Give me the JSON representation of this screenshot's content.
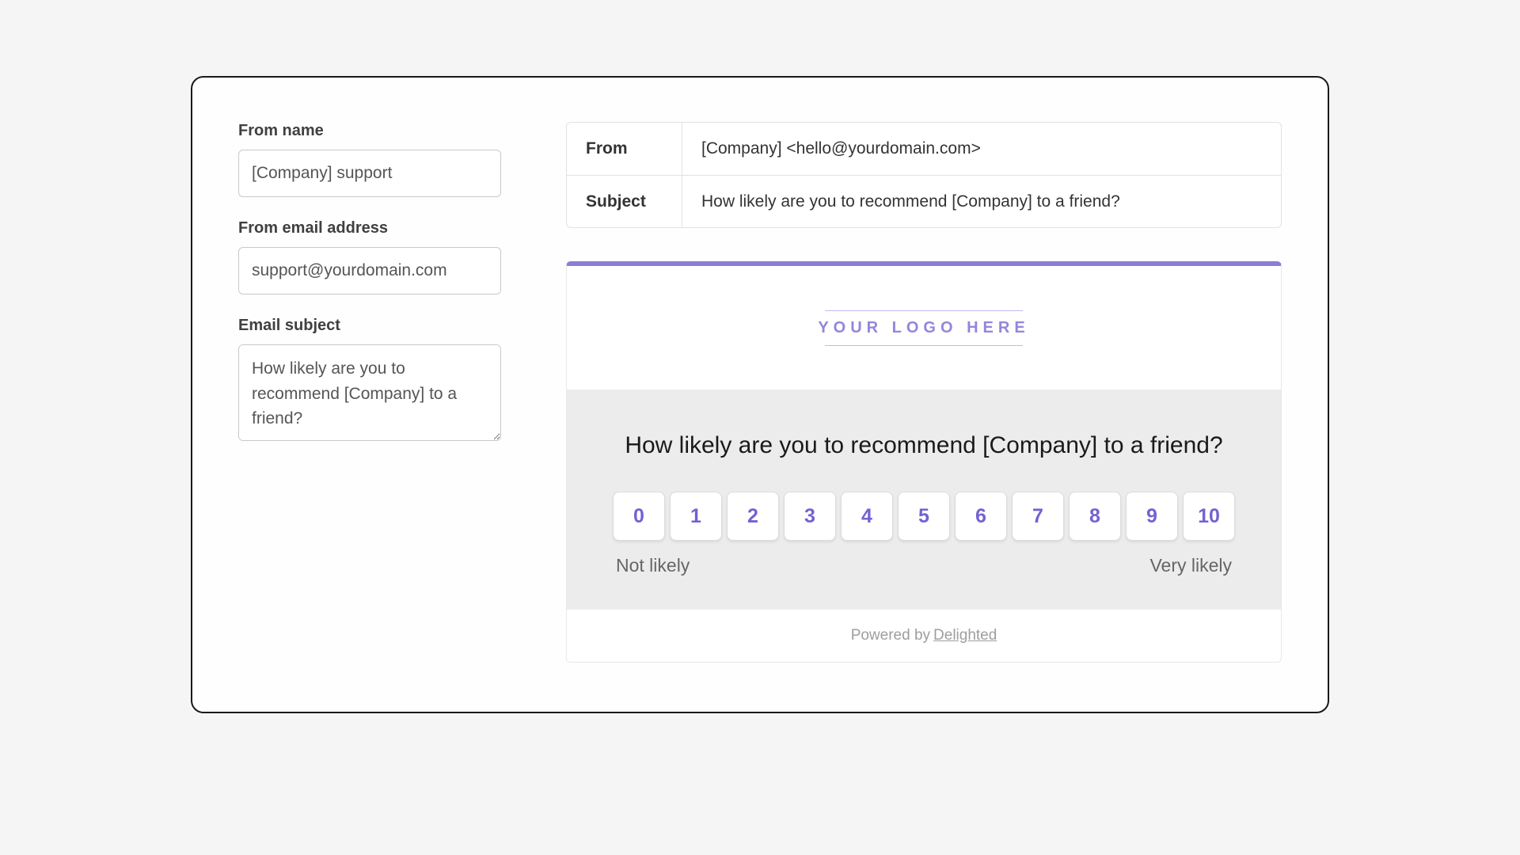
{
  "form": {
    "from_name": {
      "label": "From name",
      "value": "[Company] support"
    },
    "from_email": {
      "label": "From email address",
      "value": "support@yourdomain.com"
    },
    "subject": {
      "label": "Email subject",
      "value": "How likely are you to recommend [Company] to a friend?"
    }
  },
  "preview": {
    "headers": {
      "from_key": "From",
      "from_val": "[Company] <hello@yourdomain.com>",
      "subject_key": "Subject",
      "subject_val": "How likely are you to recommend [Company] to a friend?"
    },
    "logo_placeholder": "YOUR LOGO HERE",
    "question": "How likely are you to recommend [Company] to a friend?",
    "scores": [
      "0",
      "1",
      "2",
      "3",
      "4",
      "5",
      "6",
      "7",
      "8",
      "9",
      "10"
    ],
    "low_label": "Not likely",
    "high_label": "Very likely",
    "footer_prefix": "Powered by ",
    "footer_brand": "Delighted"
  }
}
